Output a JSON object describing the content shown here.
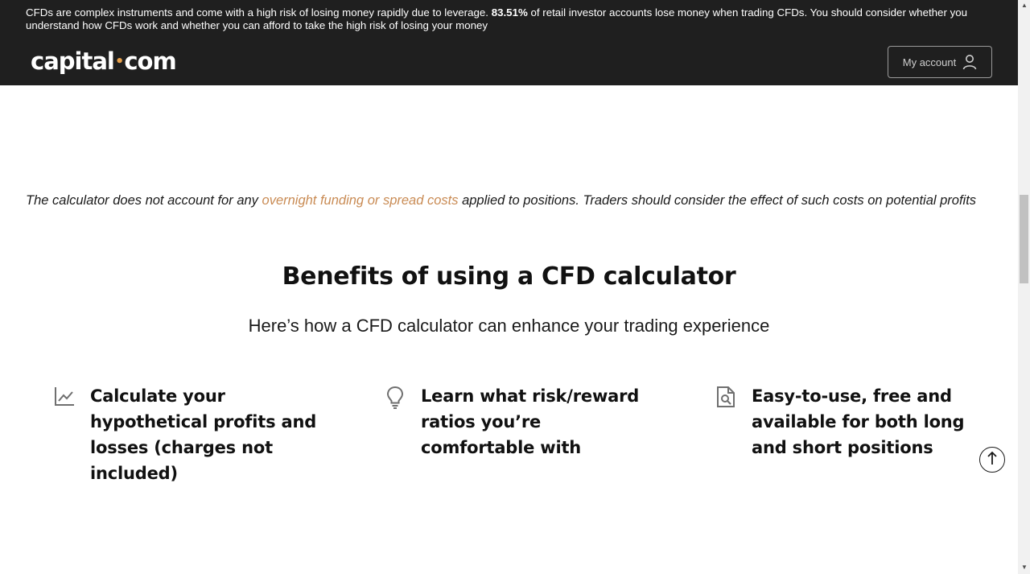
{
  "header": {
    "risk_warning_before": "CFDs are complex instruments and come with a high risk of losing money rapidly due to leverage. ",
    "risk_percent": "83.51%",
    "risk_warning_after": " of retail investor accounts lose money when trading CFDs. You should consider whether you understand how CFDs work and whether you can afford to take the high risk of losing your money",
    "logo_left": "capital",
    "logo_dot": "•",
    "logo_right": "com",
    "account_label": "My account",
    "background_color": "#1f1f1f"
  },
  "disclaimer": {
    "before": "The calculator does not account for any ",
    "link": "overnight funding or spread costs",
    "after": " applied to positions. Traders should consider the effect of such costs on potential profits",
    "link_color": "#c98b54"
  },
  "benefits_section": {
    "title": "Benefits of using a CFD calculator",
    "subtitle": "Here’s how a CFD calculator can enhance your trading experience",
    "items": [
      {
        "icon": "chart-line-icon",
        "text": "Calculate your hypothetical profits and losses (charges not included)"
      },
      {
        "icon": "lightbulb-icon",
        "text": "Learn what risk/reward ratios you’re comfortable with"
      },
      {
        "icon": "document-search-icon",
        "text": "Easy-to-use, free and available for both long and short positions"
      }
    ]
  },
  "back_to_top": {
    "icon": "arrow-up-icon"
  },
  "scrollbar": {
    "up_arrow": "▲",
    "down_arrow": "▼"
  }
}
